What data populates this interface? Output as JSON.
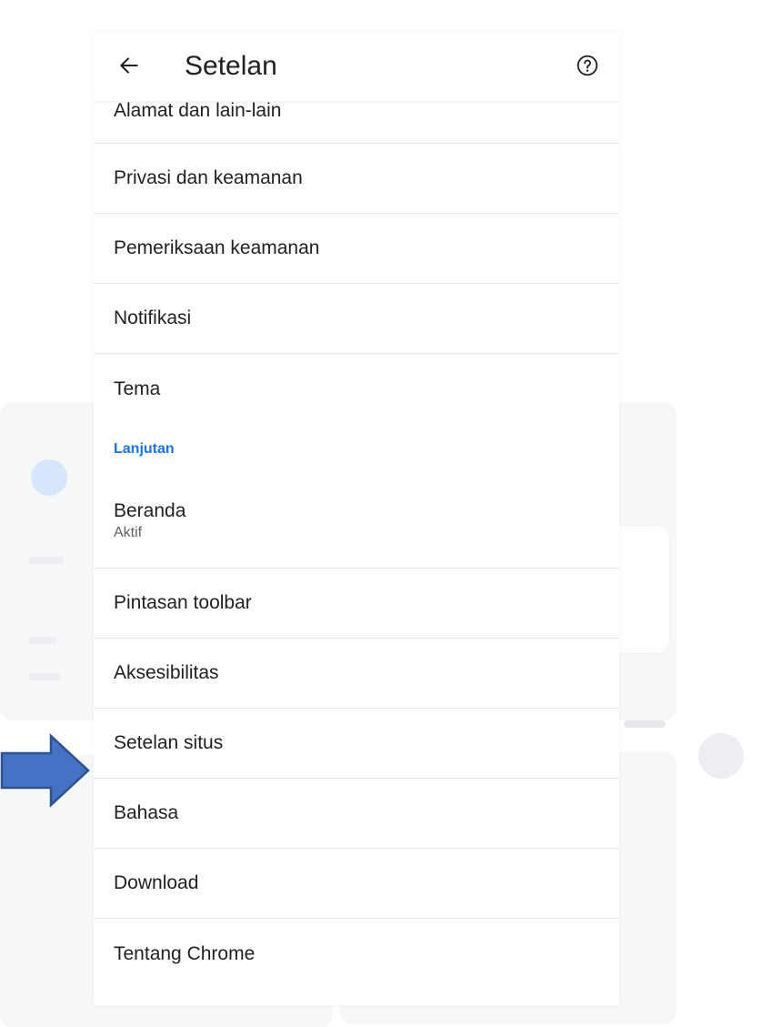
{
  "header": {
    "title": "Setelan"
  },
  "settings": {
    "items": [
      {
        "label": "Alamat dan lain-lain"
      },
      {
        "label": "Privasi dan keamanan"
      },
      {
        "label": "Pemeriksaan keamanan"
      },
      {
        "label": "Notifikasi"
      },
      {
        "label": "Tema"
      }
    ],
    "section_label": "Lanjutan",
    "advanced": [
      {
        "label": "Beranda",
        "sub": "Aktif"
      },
      {
        "label": "Pintasan toolbar"
      },
      {
        "label": "Aksesibilitas"
      },
      {
        "label": "Setelan situs"
      },
      {
        "label": "Bahasa"
      },
      {
        "label": "Download"
      },
      {
        "label": "Tentang Chrome"
      }
    ]
  },
  "icons": {
    "back": "arrow-left-icon",
    "help": "help-circle-icon",
    "pointer": "arrow-right-icon"
  },
  "colors": {
    "accent": "#1a73e8",
    "text": "#202124",
    "arrow_fill": "#4472c4",
    "arrow_stroke": "#2f528f"
  }
}
